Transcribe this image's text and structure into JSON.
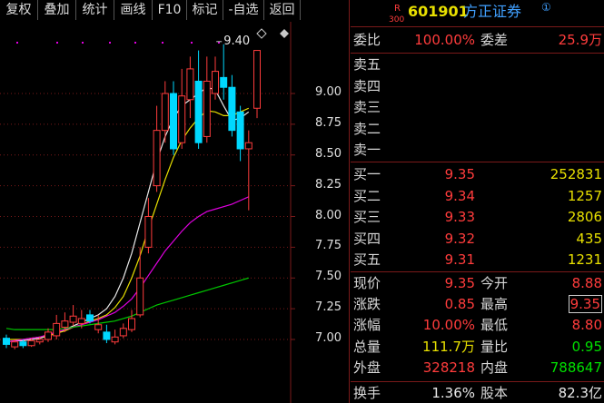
{
  "toolbar": {
    "items": [
      "复权",
      "叠加",
      "统计",
      "画线",
      "F10",
      "标记",
      "-自选",
      "返回"
    ]
  },
  "stock": {
    "badge_top": "R",
    "badge_bottom": "300",
    "code": "601901",
    "name": "方正证券",
    "mark": "①"
  },
  "order_ratio": {
    "label": "委比",
    "value": "100.00%",
    "diff_label": "委差",
    "diff_value": "25.9万"
  },
  "asks": [
    {
      "label": "卖五",
      "price": "",
      "volume": ""
    },
    {
      "label": "卖四",
      "price": "",
      "volume": ""
    },
    {
      "label": "卖三",
      "price": "",
      "volume": ""
    },
    {
      "label": "卖二",
      "price": "",
      "volume": ""
    },
    {
      "label": "卖一",
      "price": "",
      "volume": ""
    }
  ],
  "bids": [
    {
      "label": "买一",
      "price": "9.35",
      "volume": "252831"
    },
    {
      "label": "买二",
      "price": "9.34",
      "volume": "1257"
    },
    {
      "label": "买三",
      "price": "9.33",
      "volume": "2806"
    },
    {
      "label": "买四",
      "price": "9.32",
      "volume": "435"
    },
    {
      "label": "买五",
      "price": "9.31",
      "volume": "1231"
    }
  ],
  "stats": [
    {
      "l1": "现价",
      "v1": "9.35",
      "c1": "red",
      "l2": "今开",
      "v2": "8.88",
      "c2": "red"
    },
    {
      "l1": "涨跌",
      "v1": "0.85",
      "c1": "red",
      "l2": "最高",
      "v2": "9.35",
      "c2": "red"
    },
    {
      "l1": "涨幅",
      "v1": "10.00%",
      "c1": "red",
      "l2": "最低",
      "v2": "8.80",
      "c2": "red"
    },
    {
      "l1": "总量",
      "v1": "111.7万",
      "c1": "yellow",
      "l2": "量比",
      "v2": "0.95",
      "c2": "green"
    },
    {
      "l1": "外盘",
      "v1": "328218",
      "c1": "red",
      "l2": "内盘",
      "v2": "788647",
      "c2": "green"
    },
    {
      "l1": "换手",
      "v1": "1.36%",
      "c1": "white",
      "l2": "股本",
      "v2": "82.3亿",
      "c2": "white"
    }
  ],
  "chart_data": {
    "type": "candlestick",
    "y_ticks": [
      "9.00",
      "8.75",
      "8.50",
      "8.25",
      "8.00",
      "7.75",
      "7.50",
      "7.25",
      "7.00"
    ],
    "ylim": [
      6.93,
      9.45
    ],
    "high_label": "9.40",
    "candles": [
      {
        "o": 6.96,
        "c": 7.01,
        "h": 7.04,
        "l": 6.93,
        "up": false
      },
      {
        "o": 6.94,
        "c": 6.98,
        "h": 7.0,
        "l": 6.92,
        "up": true
      },
      {
        "o": 6.98,
        "c": 6.95,
        "h": 7.0,
        "l": 6.93,
        "up": false
      },
      {
        "o": 6.95,
        "c": 6.99,
        "h": 7.01,
        "l": 6.94,
        "up": true
      },
      {
        "o": 6.98,
        "c": 7.0,
        "h": 7.02,
        "l": 6.96,
        "up": true
      },
      {
        "o": 7.0,
        "c": 7.06,
        "h": 7.09,
        "l": 6.98,
        "up": true
      },
      {
        "o": 7.03,
        "c": 7.13,
        "h": 7.2,
        "l": 7.0,
        "up": true
      },
      {
        "o": 7.1,
        "c": 7.15,
        "h": 7.22,
        "l": 7.06,
        "up": true
      },
      {
        "o": 7.14,
        "c": 7.19,
        "h": 7.28,
        "l": 7.11,
        "up": true
      },
      {
        "o": 7.13,
        "c": 7.17,
        "h": 7.24,
        "l": 7.09,
        "up": true
      },
      {
        "o": 7.2,
        "c": 7.15,
        "h": 7.24,
        "l": 7.13,
        "up": false
      },
      {
        "o": 7.08,
        "c": 7.12,
        "h": 7.2,
        "l": 7.05,
        "up": true
      },
      {
        "o": 7.0,
        "c": 7.06,
        "h": 7.12,
        "l": 6.97,
        "up": false
      },
      {
        "o": 6.98,
        "c": 7.02,
        "h": 7.08,
        "l": 6.96,
        "up": true
      },
      {
        "o": 7.03,
        "c": 7.09,
        "h": 7.13,
        "l": 7.01,
        "up": true
      },
      {
        "o": 7.08,
        "c": 7.17,
        "h": 7.24,
        "l": 7.06,
        "up": true
      },
      {
        "o": 7.2,
        "c": 7.5,
        "h": 7.75,
        "l": 7.18,
        "up": true
      },
      {
        "o": 7.75,
        "c": 8.0,
        "h": 8.15,
        "l": 7.7,
        "up": true
      },
      {
        "o": 8.25,
        "c": 8.7,
        "h": 8.9,
        "l": 8.2,
        "up": true
      },
      {
        "o": 8.7,
        "c": 9.0,
        "h": 9.1,
        "l": 8.6,
        "up": true
      },
      {
        "o": 9.0,
        "c": 8.55,
        "h": 9.1,
        "l": 8.5,
        "up": false
      },
      {
        "o": 8.6,
        "c": 8.98,
        "h": 9.2,
        "l": 8.55,
        "up": true
      },
      {
        "o": 8.95,
        "c": 9.2,
        "h": 9.3,
        "l": 8.8,
        "up": true
      },
      {
        "o": 9.1,
        "c": 8.6,
        "h": 9.35,
        "l": 8.55,
        "up": false
      },
      {
        "o": 8.65,
        "c": 9.1,
        "h": 9.3,
        "l": 8.6,
        "up": true
      },
      {
        "o": 9.0,
        "c": 9.18,
        "h": 9.3,
        "l": 8.95,
        "up": true
      },
      {
        "o": 9.13,
        "c": 9.05,
        "h": 9.4,
        "l": 8.95,
        "up": false
      },
      {
        "o": 9.05,
        "c": 8.7,
        "h": 9.15,
        "l": 8.65,
        "up": false
      },
      {
        "o": 8.85,
        "c": 8.55,
        "h": 8.9,
        "l": 8.45,
        "up": false
      },
      {
        "o": 8.55,
        "c": 8.6,
        "h": 8.7,
        "l": 8.05,
        "up": true
      },
      {
        "o": 8.88,
        "c": 9.35,
        "h": 9.35,
        "l": 8.8,
        "up": true
      }
    ],
    "ma": [
      {
        "color": "#e8e8e8",
        "values": [
          6.98,
          6.99,
          6.99,
          7.0,
          7.01,
          7.03,
          7.05,
          7.08,
          7.11,
          7.14,
          7.17,
          7.2,
          7.25,
          7.35,
          7.5,
          7.7,
          7.95,
          8.2,
          8.45,
          8.65,
          8.8,
          8.9,
          8.95,
          9.0,
          9.05,
          9.03,
          8.9,
          8.78,
          8.8,
          8.85
        ]
      },
      {
        "color": "#e8e000",
        "values": [
          7.0,
          7.0,
          7.0,
          7.01,
          7.02,
          7.03,
          7.05,
          7.07,
          7.1,
          7.12,
          7.15,
          7.17,
          7.2,
          7.26,
          7.35,
          7.5,
          7.68,
          7.9,
          8.1,
          8.3,
          8.48,
          8.62,
          8.72,
          8.8,
          8.86,
          8.85,
          8.82,
          8.82,
          8.85,
          8.88
        ]
      },
      {
        "color": "#e000e0",
        "values": [
          6.98,
          6.99,
          7.0,
          7.01,
          7.02,
          7.04,
          7.06,
          7.08,
          7.1,
          7.12,
          7.14,
          7.16,
          7.19,
          7.22,
          7.27,
          7.33,
          7.42,
          7.52,
          7.62,
          7.72,
          7.8,
          7.88,
          7.95,
          8.0,
          8.04,
          8.06,
          8.08,
          8.1,
          8.13,
          8.16
        ]
      },
      {
        "color": "#00c800",
        "values": [
          7.09,
          7.08,
          7.08,
          7.08,
          7.08,
          7.08,
          7.08,
          7.09,
          7.1,
          7.11,
          7.12,
          7.13,
          7.14,
          7.15,
          7.17,
          7.19,
          7.22,
          7.25,
          7.28,
          7.3,
          7.32,
          7.34,
          7.36,
          7.38,
          7.4,
          7.42,
          7.44,
          7.46,
          7.48,
          7.5
        ]
      }
    ]
  }
}
